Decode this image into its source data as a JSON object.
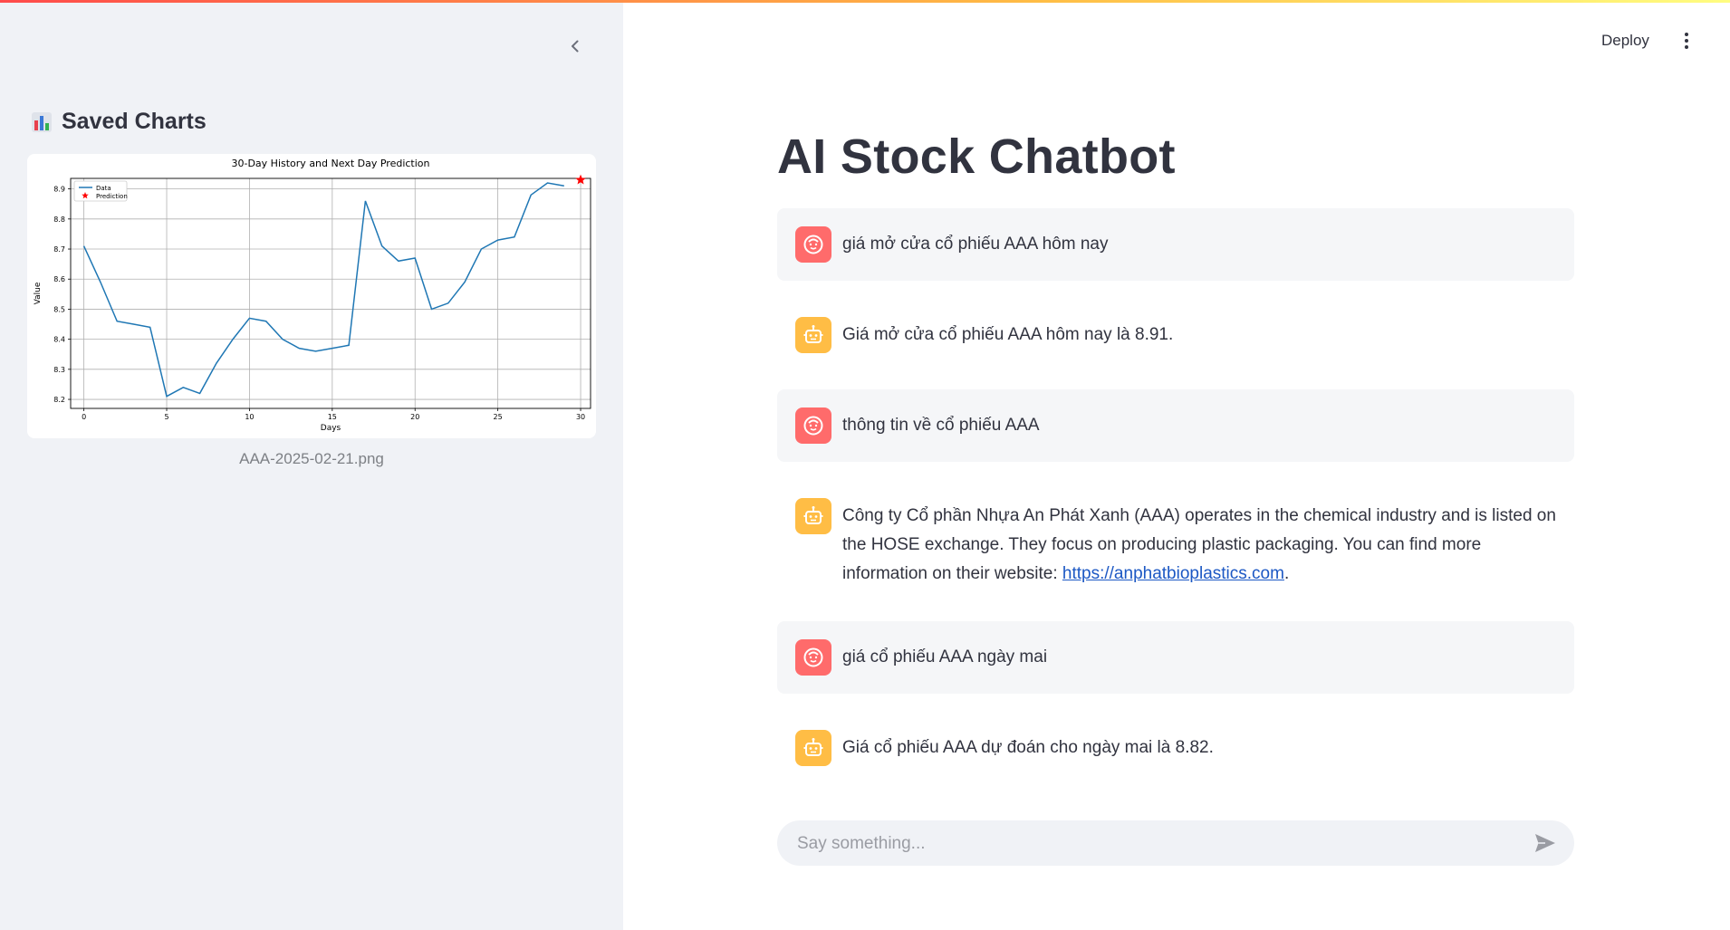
{
  "sidebar": {
    "title": "Saved Charts",
    "chart_caption": "AAA-2025-02-21.png"
  },
  "topbar": {
    "deploy_label": "Deploy"
  },
  "main": {
    "title": "AI Stock Chatbot"
  },
  "messages": [
    {
      "role": "user",
      "text": "giá mở cửa cổ phiếu AAA hôm nay"
    },
    {
      "role": "assistant",
      "text": "Giá mở cửa cổ phiếu AAA hôm nay là 8.91."
    },
    {
      "role": "user",
      "text": "thông tin về cổ phiếu AAA"
    },
    {
      "role": "assistant",
      "text_before": "Công ty Cổ phần Nhựa An Phát Xanh (AAA) operates in the chemical industry and is listed on the HOSE exchange. They focus on producing plastic packaging. You can find more information on their website: ",
      "link": "https://anphatbioplastics.com",
      "text_after": "."
    },
    {
      "role": "user",
      "text": "giá cổ phiếu AAA ngày mai"
    },
    {
      "role": "assistant",
      "text": "Giá cổ phiếu AAA dự đoán cho ngày mai là 8.82."
    }
  ],
  "chat_input": {
    "placeholder": "Say something..."
  },
  "colors": {
    "user_avatar": "#ff6b6b",
    "assistant_avatar": "#ffbd45",
    "line": "#1f77b4",
    "prediction": "#ff0000"
  },
  "chart_data": {
    "type": "line",
    "title": "30-Day History and Next Day Prediction",
    "xlabel": "Days",
    "ylabel": "Value",
    "xlim": [
      0,
      30
    ],
    "ylim": [
      8.2,
      8.9
    ],
    "xticks": [
      0,
      5,
      10,
      15,
      20,
      25,
      30
    ],
    "yticks": [
      8.2,
      8.3,
      8.4,
      8.5,
      8.6,
      8.7,
      8.8,
      8.9
    ],
    "grid": true,
    "legend": "top-left",
    "series": [
      {
        "name": "Data",
        "x": [
          0,
          1,
          2,
          3,
          4,
          5,
          6,
          7,
          8,
          9,
          10,
          11,
          12,
          13,
          14,
          15,
          16,
          17,
          18,
          19,
          20,
          21,
          22,
          23,
          24,
          25,
          26,
          27,
          28,
          29
        ],
        "values": [
          8.71,
          8.59,
          8.46,
          8.45,
          8.44,
          8.21,
          8.24,
          8.22,
          8.32,
          8.4,
          8.47,
          8.46,
          8.4,
          8.37,
          8.36,
          8.37,
          8.38,
          8.86,
          8.71,
          8.66,
          8.67,
          8.5,
          8.52,
          8.59,
          8.7,
          8.73,
          8.74,
          8.88,
          8.92,
          8.91
        ]
      },
      {
        "name": "Prediction",
        "x": [
          30
        ],
        "values": [
          8.93
        ]
      }
    ]
  }
}
